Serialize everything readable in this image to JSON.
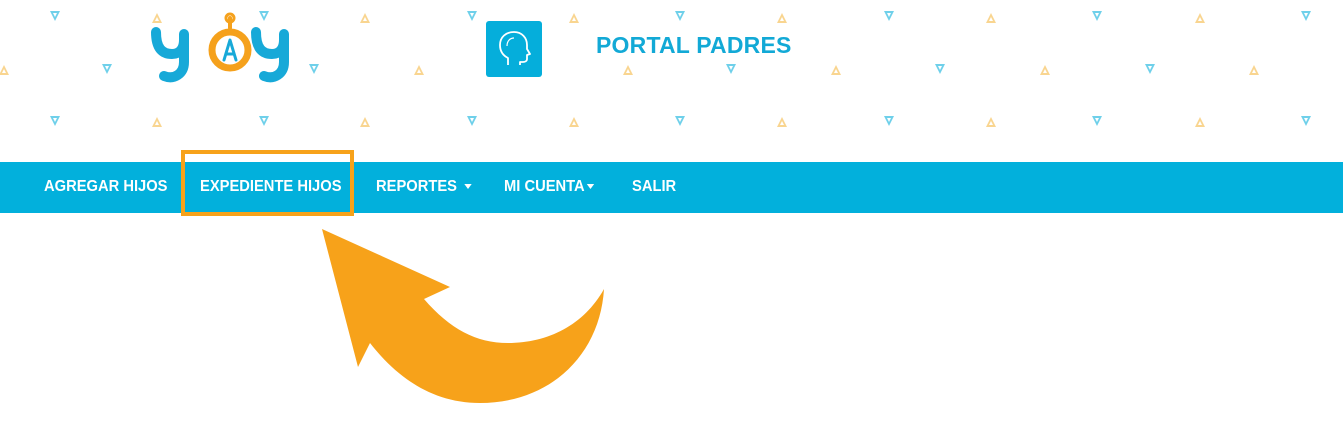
{
  "header": {
    "logo_text": "yoy",
    "portal_title": "PORTAL PADRES",
    "portal_icon": "head-profile-icon"
  },
  "nav": {
    "items": [
      {
        "label": "AGREGAR HIJOS"
      },
      {
        "label": "EXPEDIENTE HIJOS",
        "highlighted": true
      },
      {
        "label": "REPORTES",
        "dropdown": true
      },
      {
        "label": "MI CUENTA",
        "dropdown": true
      },
      {
        "label": "SALIR"
      }
    ]
  },
  "annotation": {
    "highlight_color": "#f7a21a",
    "arrow_color": "#f7a21a",
    "arrow_icon": "curved-arrow-icon"
  },
  "colors": {
    "navbar": "#02b0dc",
    "title": "#12a9d6",
    "pattern_blue": "#6fd0ea",
    "pattern_orange": "#f9d590"
  }
}
